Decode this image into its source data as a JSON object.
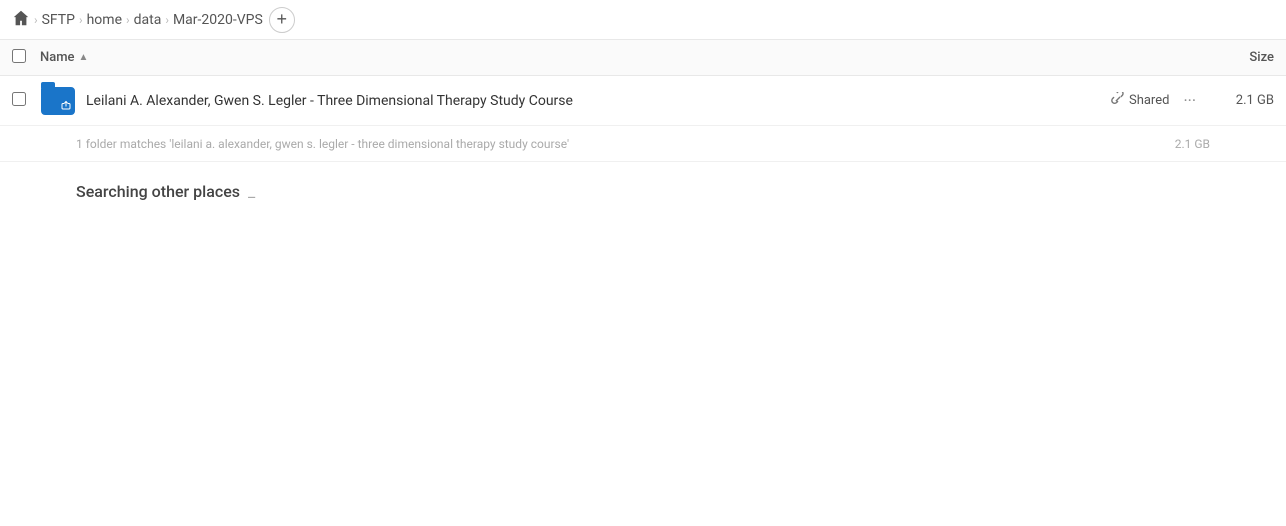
{
  "breadcrumb": {
    "home_label": "Home",
    "items": [
      {
        "label": "SFTP"
      },
      {
        "label": "home"
      },
      {
        "label": "data"
      },
      {
        "label": "Mar-2020-VPS"
      }
    ],
    "add_button_label": "+"
  },
  "table": {
    "col_name": "Name",
    "col_name_sort": "▲",
    "col_size": "Size"
  },
  "file_row": {
    "name": "Leilani A. Alexander, Gwen S. Legler - Three Dimensional Therapy Study Course",
    "shared_label": "Shared",
    "more_label": "···",
    "size": "2.1 GB"
  },
  "result_info": {
    "text": "1 folder matches 'leilani a. alexander, gwen s. legler - three dimensional therapy study course'",
    "size": "2.1 GB"
  },
  "searching": {
    "label": "Searching other places",
    "dots": "_"
  }
}
